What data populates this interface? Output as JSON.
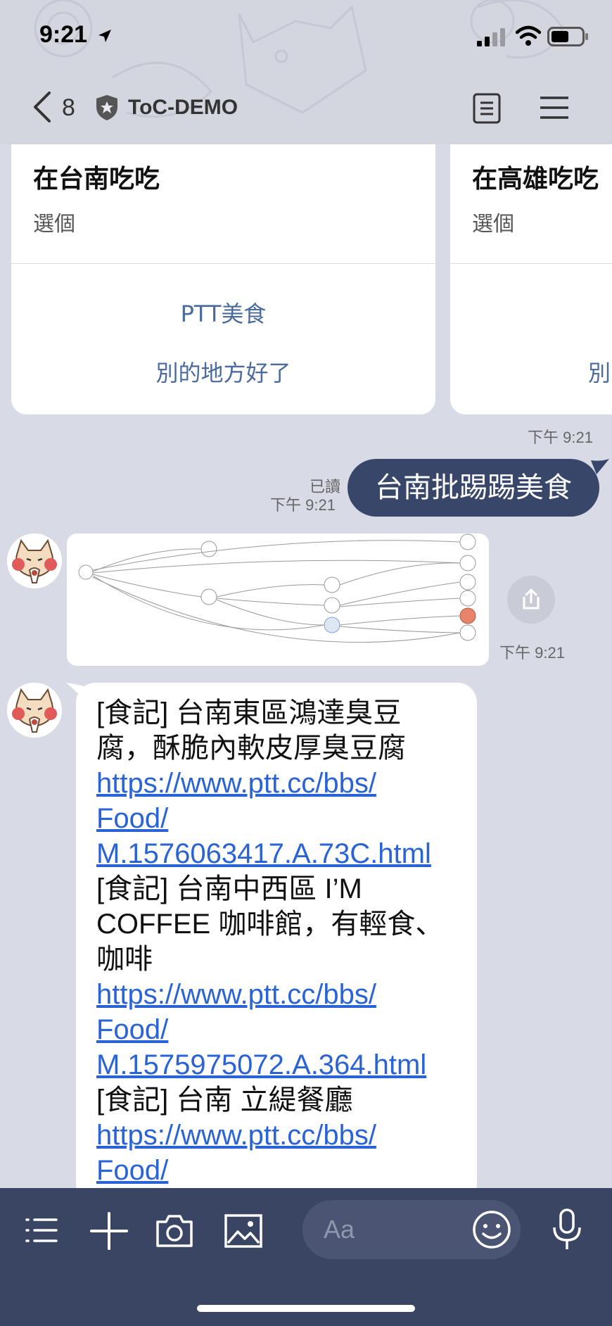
{
  "status_bar": {
    "time": "9:21"
  },
  "nav": {
    "back_count": "8",
    "title": "ToC-DEMO"
  },
  "cards": [
    {
      "title": "在台南吃吃",
      "subtitle": "選個",
      "actions": [
        "PTT美食",
        "別的地方好了"
      ]
    },
    {
      "title": "在高雄吃吃",
      "subtitle": "選個",
      "actions": [
        "",
        "別"
      ]
    }
  ],
  "carousel_time": "下午 9:21",
  "outgoing": {
    "text": "台南批踢踢美食",
    "read_label": "已讀",
    "time": "下午 9:21"
  },
  "image_message": {
    "time": "下午 9:21"
  },
  "text_message": {
    "lines": [
      {
        "text": "[食記] 台南東區鴻達臭豆",
        "link": false
      },
      {
        "text": "腐，酥脆內軟皮厚臭豆腐",
        "link": false
      },
      {
        "text": "https://www.ptt.cc/bbs/",
        "link": true
      },
      {
        "text": "Food/",
        "link": true
      },
      {
        "text": "M.1576063417.A.73C.html",
        "link": true
      },
      {
        "text": "[食記] 台南中西區 I’M",
        "link": false
      },
      {
        "text": "COFFEE 咖啡館，有輕食、",
        "link": false
      },
      {
        "text": "咖啡",
        "link": false
      },
      {
        "text": "https://www.ptt.cc/bbs/",
        "link": true
      },
      {
        "text": "Food/",
        "link": true
      },
      {
        "text": "M.1575975072.A.364.html",
        "link": true
      },
      {
        "text": "[食記] 台南 立緹餐廳",
        "link": false
      },
      {
        "text": "https://www.ptt.cc/bbs/",
        "link": true
      },
      {
        "text": "Food/",
        "link": true
      }
    ]
  },
  "input": {
    "placeholder": "Aa"
  },
  "icons": {
    "status": [
      "location-arrow-icon",
      "signal-icon",
      "wifi-icon",
      "battery-icon"
    ],
    "nav": [
      "chevron-left-icon",
      "shield-icon",
      "notes-icon",
      "menu-icon"
    ],
    "toolbar": [
      "list-icon",
      "plus-icon",
      "camera-icon",
      "image-icon",
      "emoji-icon",
      "microphone-icon"
    ]
  },
  "colors": {
    "background": "#d8dae6",
    "bubble_out": "#384669",
    "link": "#2a63d6",
    "bottom_bar": "#3a4564"
  }
}
